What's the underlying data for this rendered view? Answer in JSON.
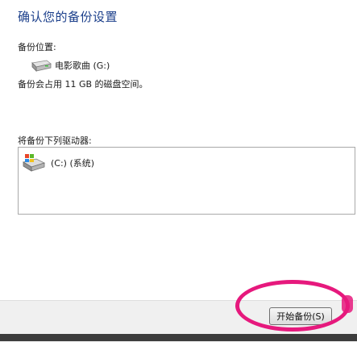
{
  "dialog": {
    "title": "确认您的备份设置"
  },
  "backup_location": {
    "label": "备份位置:",
    "drive_name": "电影歌曲 (G:)",
    "space_text": "备份会占用 11 GB 的磁盘空间。"
  },
  "drive_list": {
    "label": "将备份下列驱动器:",
    "items": [
      {
        "label": "(C:) (系统)",
        "icon": "windows-drive-icon"
      }
    ]
  },
  "footer": {
    "start_button_label": "开始备份(S)"
  },
  "colors": {
    "title": "#1b3f8b",
    "annotation": "#e6197d",
    "footer_bg": "#f0f0f0"
  }
}
